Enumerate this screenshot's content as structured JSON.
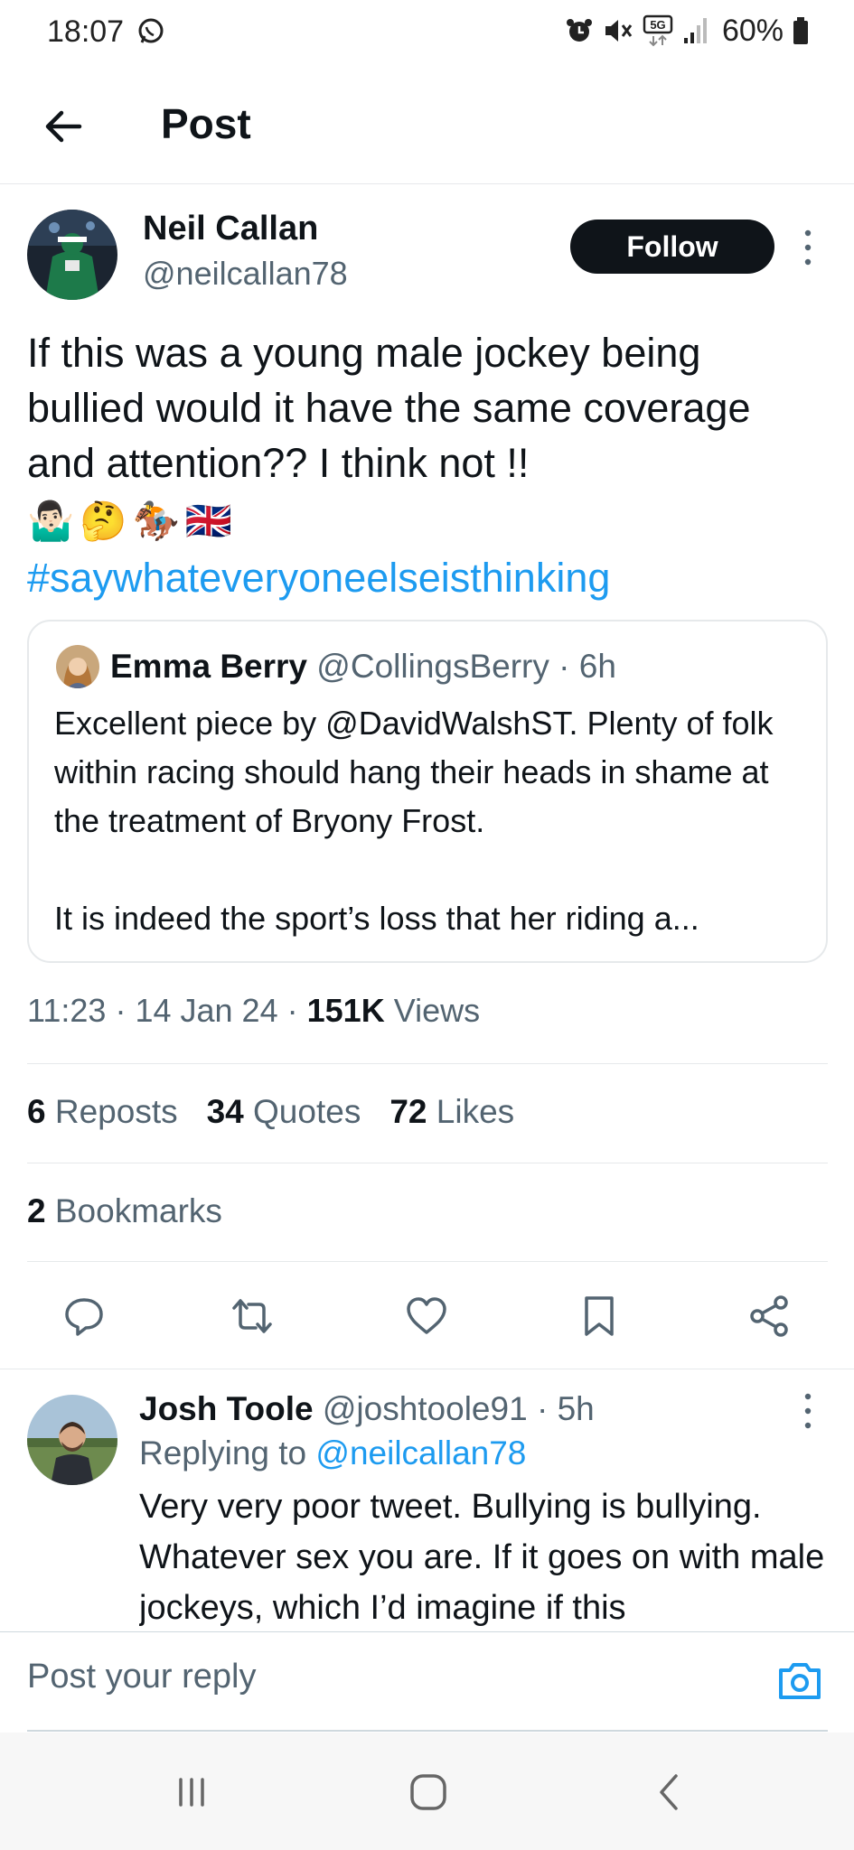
{
  "status_bar": {
    "time": "18:07",
    "network": "5G",
    "battery": "60%"
  },
  "header": {
    "title": "Post"
  },
  "tweet": {
    "author_name": "Neil Callan",
    "author_handle": "@neilcallan78",
    "follow_label": "Follow",
    "text": "If this was a young male jockey being bullied would it have the same coverage and attention?? I think not !!",
    "emojis": [
      "🤷🏻‍♂️",
      "🤔",
      "🏇",
      "🇬🇧"
    ],
    "hashtag": "#saywhateveryoneelseisthinking",
    "quote": {
      "name": "Emma Berry",
      "handle": "@CollingsBerry",
      "sep": "·",
      "time": "6h",
      "text_1": "Excellent piece by @DavidWalshST. Plenty of folk within racing should hang their heads in shame at the treatment of Bryony Frost.",
      "text_2": "It is indeed the sport’s loss that her riding a..."
    },
    "time": "11:23",
    "sep": "·",
    "date": "14 Jan 24",
    "views_count": "151K",
    "views_label": "Views",
    "reposts_count": "6",
    "reposts_label": "Reposts",
    "quotes_count": "34",
    "quotes_label": "Quotes",
    "likes_count": "72",
    "likes_label": "Likes",
    "bookmarks_count": "2",
    "bookmarks_label": "Bookmarks"
  },
  "reply": {
    "name": "Josh Toole",
    "handle": "@joshtoole91",
    "sep": "·",
    "time": "5h",
    "replying_label": "Replying to",
    "replying_to": "@neilcallan78",
    "text": "Very very poor tweet. Bullying is bullying. Whatever sex you are. If it goes on with male jockeys, which I’d imagine if this"
  },
  "composer": {
    "placeholder": "Post your reply"
  },
  "icons": {
    "back": "arrow-left-icon",
    "more": "more-vertical-icon",
    "reply": "reply-icon",
    "repost": "repost-icon",
    "like": "heart-icon",
    "bookmark": "bookmark-icon",
    "share": "share-icon",
    "camera": "camera-icon"
  },
  "colors": {
    "accent": "#1d9bf0",
    "text": "#0f1419",
    "secondary": "#536471",
    "border": "#e6e9eb"
  }
}
